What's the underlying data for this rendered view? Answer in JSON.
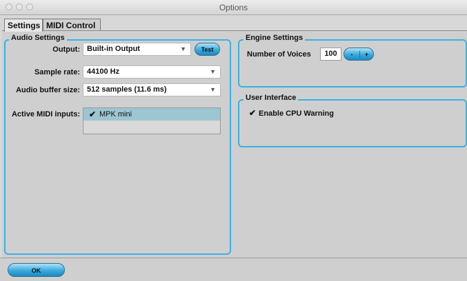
{
  "window": {
    "title": "Options"
  },
  "tabs": [
    {
      "label": "Settings"
    },
    {
      "label": "MIDI Control"
    }
  ],
  "audio_settings": {
    "group_title": "Audio Settings",
    "output_label": "Output:",
    "output_value": "Built-in Output",
    "test_button": "Test",
    "sample_rate_label": "Sample rate:",
    "sample_rate_value": "44100 Hz",
    "buffer_label": "Audio buffer size:",
    "buffer_value": "512 samples (11.6 ms)",
    "midi_inputs_label": "Active MIDI inputs:",
    "midi_inputs": [
      {
        "name": "MPK mini",
        "checked": true
      }
    ]
  },
  "engine_settings": {
    "group_title": "Engine Settings",
    "voices_label": "Number of Voices",
    "voices_value": "100",
    "minus_label": "-",
    "plus_label": "+"
  },
  "user_interface": {
    "group_title": "User Interface",
    "cpu_warning_label": "Enable CPU Warning",
    "cpu_warning_checked": true
  },
  "footer": {
    "ok_label": "OK"
  },
  "colors": {
    "accent": "#39b1e2",
    "button": "#2fa3d8"
  }
}
